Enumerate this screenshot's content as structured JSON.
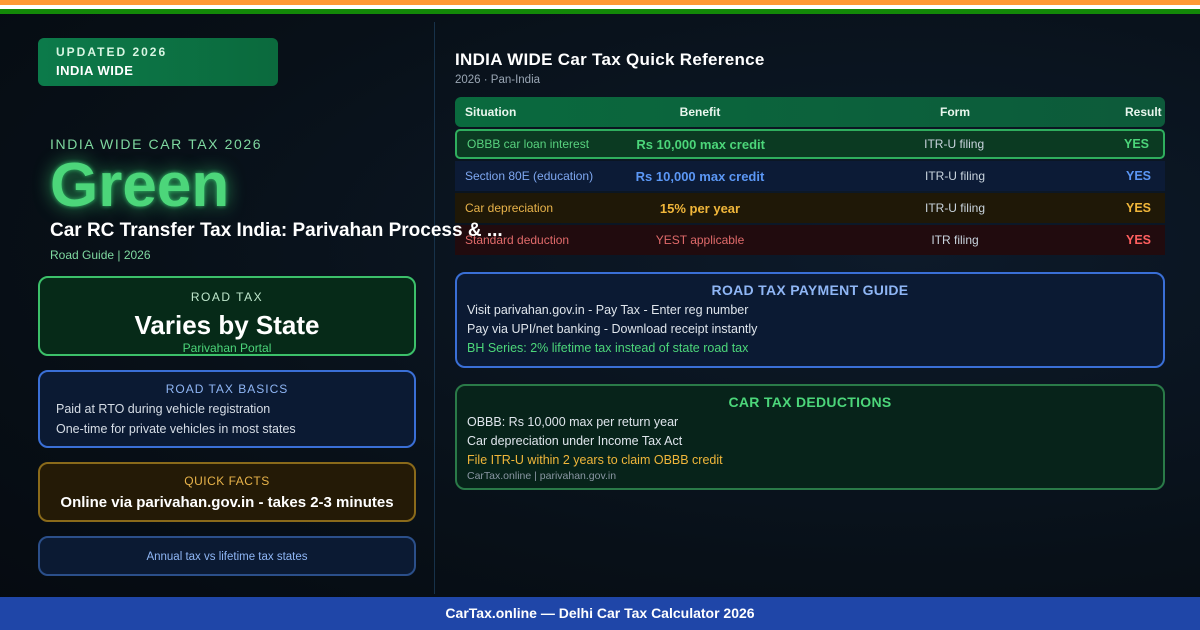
{
  "badge": {
    "line1": "UPDATED 2026",
    "line2": "INDIA WIDE"
  },
  "hero": {
    "kicker": "INDIA WIDE CAR TAX 2026",
    "big_word": "Green",
    "headline": "Car RC Transfer Tax India: Parivahan Process & ...",
    "subline": "Road Guide | 2026"
  },
  "road_tax_card": {
    "title": "ROAD TAX",
    "value": "Varies by State",
    "portal": "Parivahan Portal"
  },
  "basics_card": {
    "title": "ROAD TAX BASICS",
    "lines": [
      "Paid at RTO during vehicle registration",
      "One-time for private vehicles in most states"
    ]
  },
  "facts_card": {
    "title": "QUICK FACTS",
    "value": "Online via parivahan.gov.in - takes 2-3 minutes"
  },
  "annual_card": {
    "text": "Annual tax vs lifetime tax states"
  },
  "reference": {
    "title": "INDIA WIDE Car Tax Quick Reference",
    "subtitle": "2026 · Pan-India",
    "headers": {
      "situation": "Situation",
      "benefit": "Benefit",
      "form": "Form",
      "result": "Result"
    },
    "rows": [
      {
        "situation": "OBBB car loan interest",
        "benefit": "Rs 10,000 max credit",
        "form": "ITR-U filing",
        "result": "YES"
      },
      {
        "situation": "Section 80E (education)",
        "benefit": "Rs 10,000 max credit",
        "form": "ITR-U filing",
        "result": "YES"
      },
      {
        "situation": "Car depreciation",
        "benefit": "15% per year",
        "form": "ITR-U filing",
        "result": "YES"
      },
      {
        "situation": "Standard deduction",
        "benefit": "YEST applicable",
        "form": "ITR filing",
        "result": "YES"
      }
    ]
  },
  "payment_guide": {
    "title": "ROAD TAX PAYMENT GUIDE",
    "lines": [
      "Visit parivahan.gov.in - Pay Tax - Enter reg number",
      "Pay via UPI/net banking - Download receipt instantly",
      "BH Series: 2% lifetime tax instead of state road tax"
    ]
  },
  "deductions": {
    "title": "CAR TAX DEDUCTIONS",
    "lines": [
      "OBBB: Rs 10,000 max per return year",
      "Car depreciation under Income Tax Act",
      "File ITR-U within 2 years to claim OBBB credit"
    ],
    "source": "CarTax.online | parivahan.gov.in"
  },
  "footer": {
    "text": "CarTax.online — Delhi Car Tax Calculator 2026"
  },
  "colors": {
    "accent_green": "#4cd67a",
    "accent_blue": "#3a6fd6",
    "accent_amber": "#f0b63a",
    "accent_red": "#ff5f5f",
    "footer_blue": "#1f46a8"
  }
}
